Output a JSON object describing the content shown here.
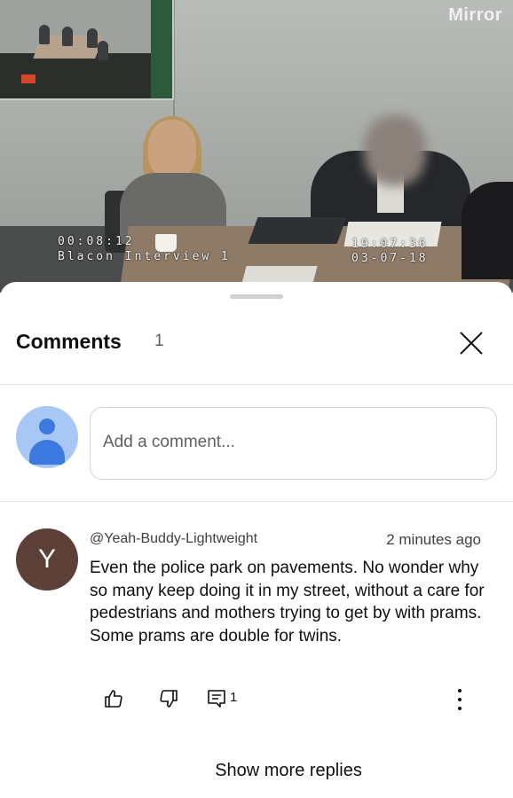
{
  "video": {
    "watermark": "Mirror",
    "osd_time": "00:08:12",
    "osd_location": "Blacon Interview 1",
    "osd_clock": "19:07:36",
    "osd_date": "03-07-18"
  },
  "comments_panel": {
    "title": "Comments",
    "count": "1",
    "close_icon": "close-icon",
    "compose_placeholder": "Add a comment...",
    "my_avatar_icon": "person-icon"
  },
  "comments": [
    {
      "avatar_letter": "Y",
      "avatar_color": "#5d4037",
      "author": "@Yeah-Buddy-Lightweight",
      "time": "2 minutes ago",
      "text": "Even the police park on pavements.  No wonder why so many keep doing it in my street, without a care for pedestrians and mothers trying to get by with prams.  Some prams are double for twins.",
      "reply_count": "1",
      "icons": [
        "thumbs-up-icon",
        "thumbs-down-icon",
        "reply-icon",
        "more-vertical-icon"
      ]
    }
  ],
  "show_more_label": "Show more replies",
  "colors": {
    "accent": "#3d7ae0",
    "avatar_bg": "#a8c7f5"
  }
}
